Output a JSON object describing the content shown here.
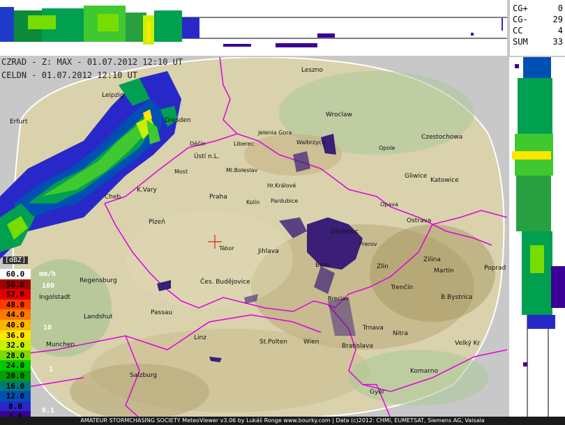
{
  "header": {
    "line1": "CZRAD - Z: MAX - 01.07.2012 12:10 UT",
    "line2": "CELDN - 01.07.2012 12:10 UT"
  },
  "counters": [
    {
      "label": "CG+",
      "value": "0"
    },
    {
      "label": "CG-",
      "value": "29"
    },
    {
      "label": "CC",
      "value": "4"
    },
    {
      "label": "SUM",
      "value": "33"
    }
  ],
  "legend": {
    "unit_label": "[dBZ]",
    "rain_unit": "mm/h",
    "steps": [
      {
        "value": "60.0",
        "color": "#ffffff",
        "text": "#000000"
      },
      {
        "value": "56.0",
        "color": "#a00000",
        "text": "#000000"
      },
      {
        "value": "52.0",
        "color": "#e00000",
        "text": "#000000"
      },
      {
        "value": "48.0",
        "color": "#ff3c00",
        "text": "#000000"
      },
      {
        "value": "44.0",
        "color": "#ff7800",
        "text": "#000000"
      },
      {
        "value": "40.0",
        "color": "#ffb400",
        "text": "#000000"
      },
      {
        "value": "36.0",
        "color": "#ffe600",
        "text": "#000000"
      },
      {
        "value": "32.0",
        "color": "#c8f000",
        "text": "#000000"
      },
      {
        "value": "28.0",
        "color": "#78dc00",
        "text": "#000000"
      },
      {
        "value": "24.0",
        "color": "#00c800",
        "text": "#000000"
      },
      {
        "value": "20.0",
        "color": "#00a000",
        "text": "#000000"
      },
      {
        "value": "16.0",
        "color": "#00787a",
        "text": "#000000"
      },
      {
        "value": "12.0",
        "color": "#0050b4",
        "text": "#000000"
      },
      {
        "value": "8.0",
        "color": "#2828c8",
        "text": "#000000"
      },
      {
        "value": "4.0",
        "color": "#3c0096",
        "text": "#000000"
      }
    ],
    "rain_marks": [
      "100",
      "10",
      "1",
      "0.1"
    ]
  },
  "cities": [
    {
      "name": "Leszno"
    },
    {
      "name": "Wroclaw"
    },
    {
      "name": "Jelenia Gora"
    },
    {
      "name": "Walbrzych"
    },
    {
      "name": "Opole"
    },
    {
      "name": "Czestochowa"
    },
    {
      "name": "Gliwice"
    },
    {
      "name": "Katowice"
    },
    {
      "name": "Opava"
    },
    {
      "name": "Ostrava"
    },
    {
      "name": "Olomouc"
    },
    {
      "name": "Prerov"
    },
    {
      "name": "Zlín"
    },
    {
      "name": "Brno"
    },
    {
      "name": "Zilina"
    },
    {
      "name": "Martin"
    },
    {
      "name": "Poprad"
    },
    {
      "name": "Trenčín"
    },
    {
      "name": "B.Bystrica"
    },
    {
      "name": "Breclav"
    },
    {
      "name": "Trnava"
    },
    {
      "name": "Nitra"
    },
    {
      "name": "Bratislava"
    },
    {
      "name": "Komarno"
    },
    {
      "name": "Velký Kr"
    },
    {
      "name": "Györ"
    },
    {
      "name": "Wien"
    },
    {
      "name": "St.Polten"
    },
    {
      "name": "Linz"
    },
    {
      "name": "Passau"
    },
    {
      "name": "Landshut"
    },
    {
      "name": "Munchen"
    },
    {
      "name": "Salzburg"
    },
    {
      "name": "Ingolstadt"
    },
    {
      "name": "Regensburg"
    },
    {
      "name": "Plzeň"
    },
    {
      "name": "Tábor"
    },
    {
      "name": "Jihlava"
    },
    {
      "name": "Čes. Budějovice"
    },
    {
      "name": "Praha"
    },
    {
      "name": "Kolín"
    },
    {
      "name": "Pardubice"
    },
    {
      "name": "Hr.Králové"
    },
    {
      "name": "Ml.Boleslav"
    },
    {
      "name": "Liberec"
    },
    {
      "name": "Ústí n.L."
    },
    {
      "name": "Děčín"
    },
    {
      "name": "Most"
    },
    {
      "name": "K.Vary"
    },
    {
      "name": "Cheb"
    },
    {
      "name": "Erfurt"
    },
    {
      "name": "Leipzig"
    },
    {
      "name": "Dresden"
    },
    {
      "name": "Tabor"
    }
  ],
  "footer": {
    "text": "AMATEUR STORMCHASING SOCIETY MeteoViewer v3.06 by Lukáš Ronge www.bourky.com | Data (c)2012: CHMI, EUMETSAT, Siemens AG, Vaisala"
  },
  "colors": {
    "border": "#e000e0",
    "radar_edge": "#ffffff",
    "terrain": "#dcd6b0",
    "lightning": "#3a1e78"
  }
}
